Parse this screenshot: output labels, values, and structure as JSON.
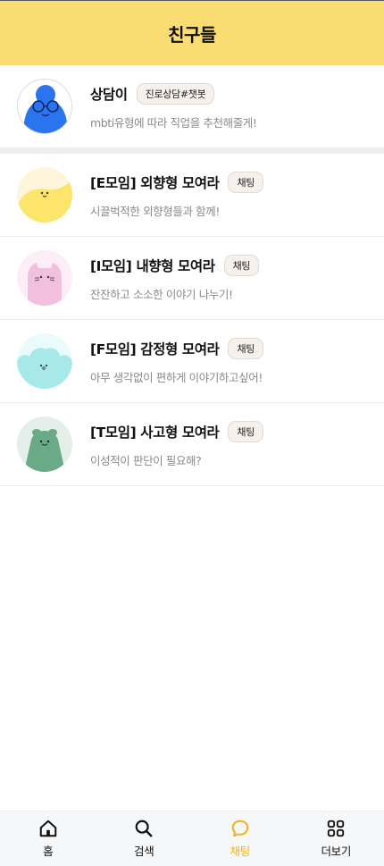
{
  "header": {
    "title": "친구들"
  },
  "counsel": {
    "name": "상담이",
    "badge": "진로상담#챗봇",
    "description": "mbti유형에 따라 직업을 추천해줄게!"
  },
  "groups": [
    {
      "name": "[E모임] 외향형 모여라",
      "badge": "채팅",
      "description": "시끌벅적한 외향형들과 함께!"
    },
    {
      "name": "[I모임] 내향형 모여라",
      "badge": "채팅",
      "description": "잔잔하고 소소한 이야기 나누기!"
    },
    {
      "name": "[F모임] 감정형 모여라",
      "badge": "채팅",
      "description": "아무 생각없이 편하게 이야기하고싶어!"
    },
    {
      "name": "[T모임] 사고형 모여라",
      "badge": "채팅",
      "description": "이성적이 판단이 필요해?"
    }
  ],
  "nav": {
    "items": [
      {
        "label": "홈",
        "icon": "home-icon",
        "active": false
      },
      {
        "label": "검색",
        "icon": "search-icon",
        "active": false
      },
      {
        "label": "채팅",
        "icon": "chat-icon",
        "active": true
      },
      {
        "label": "더보기",
        "icon": "grid-icon",
        "active": false
      }
    ]
  },
  "colors": {
    "header_bg": "#f9dd72",
    "active_nav": "#f2b01e",
    "counsel_avatar": "#2b74f0",
    "e_avatar": "#fde46b",
    "i_avatar": "#f1c0de",
    "f_avatar": "#a7e9e8",
    "t_avatar": "#6aaa86"
  }
}
